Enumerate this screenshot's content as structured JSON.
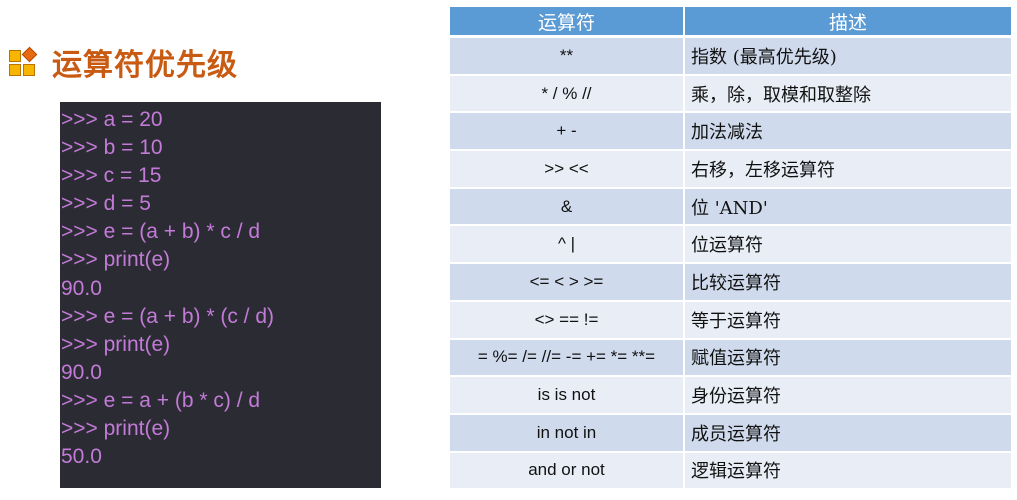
{
  "header": {
    "title": "运算符优先级",
    "icon": "blocks-icon"
  },
  "code": {
    "lines": [
      ">>> a = 20",
      ">>> b = 10",
      ">>> c = 15",
      ">>> d = 5",
      ">>> e = (a + b) * c / d",
      ">>> print(e)",
      "90.0",
      ">>> e = (a + b) * (c / d)",
      ">>> print(e)",
      "90.0",
      ">>> e = a + (b * c) / d",
      ">>> print(e)",
      "50.0"
    ]
  },
  "table": {
    "headers": [
      "运算符",
      "描述"
    ],
    "rows": [
      {
        "op": "**",
        "desc": "指数 (最高优先级)"
      },
      {
        "op": "* / % //",
        "desc": "乘，除，取模和取整除"
      },
      {
        "op": "+ -",
        "desc": "加法减法"
      },
      {
        "op": ">> <<",
        "desc": "右移，左移运算符"
      },
      {
        "op": "&",
        "desc": "位 'AND'"
      },
      {
        "op": "^ |",
        "desc": "位运算符"
      },
      {
        "op": "<= < > >=",
        "desc": "比较运算符"
      },
      {
        "op": "<> == !=",
        "desc": "等于运算符"
      },
      {
        "op": "= %= /= //= -= += *= **=",
        "desc": "赋值运算符"
      },
      {
        "op": "is is not",
        "desc": "身份运算符"
      },
      {
        "op": "in not in",
        "desc": "成员运算符"
      },
      {
        "op": "and or not",
        "desc": "逻辑运算符"
      }
    ]
  },
  "colors": {
    "title": "#c85a12",
    "header_bg": "#5b9bd5",
    "row_odd": "#cfdaec",
    "row_even": "#e8edf6",
    "code_bg": "#2b2c33",
    "code_text": "#c37ad8"
  }
}
